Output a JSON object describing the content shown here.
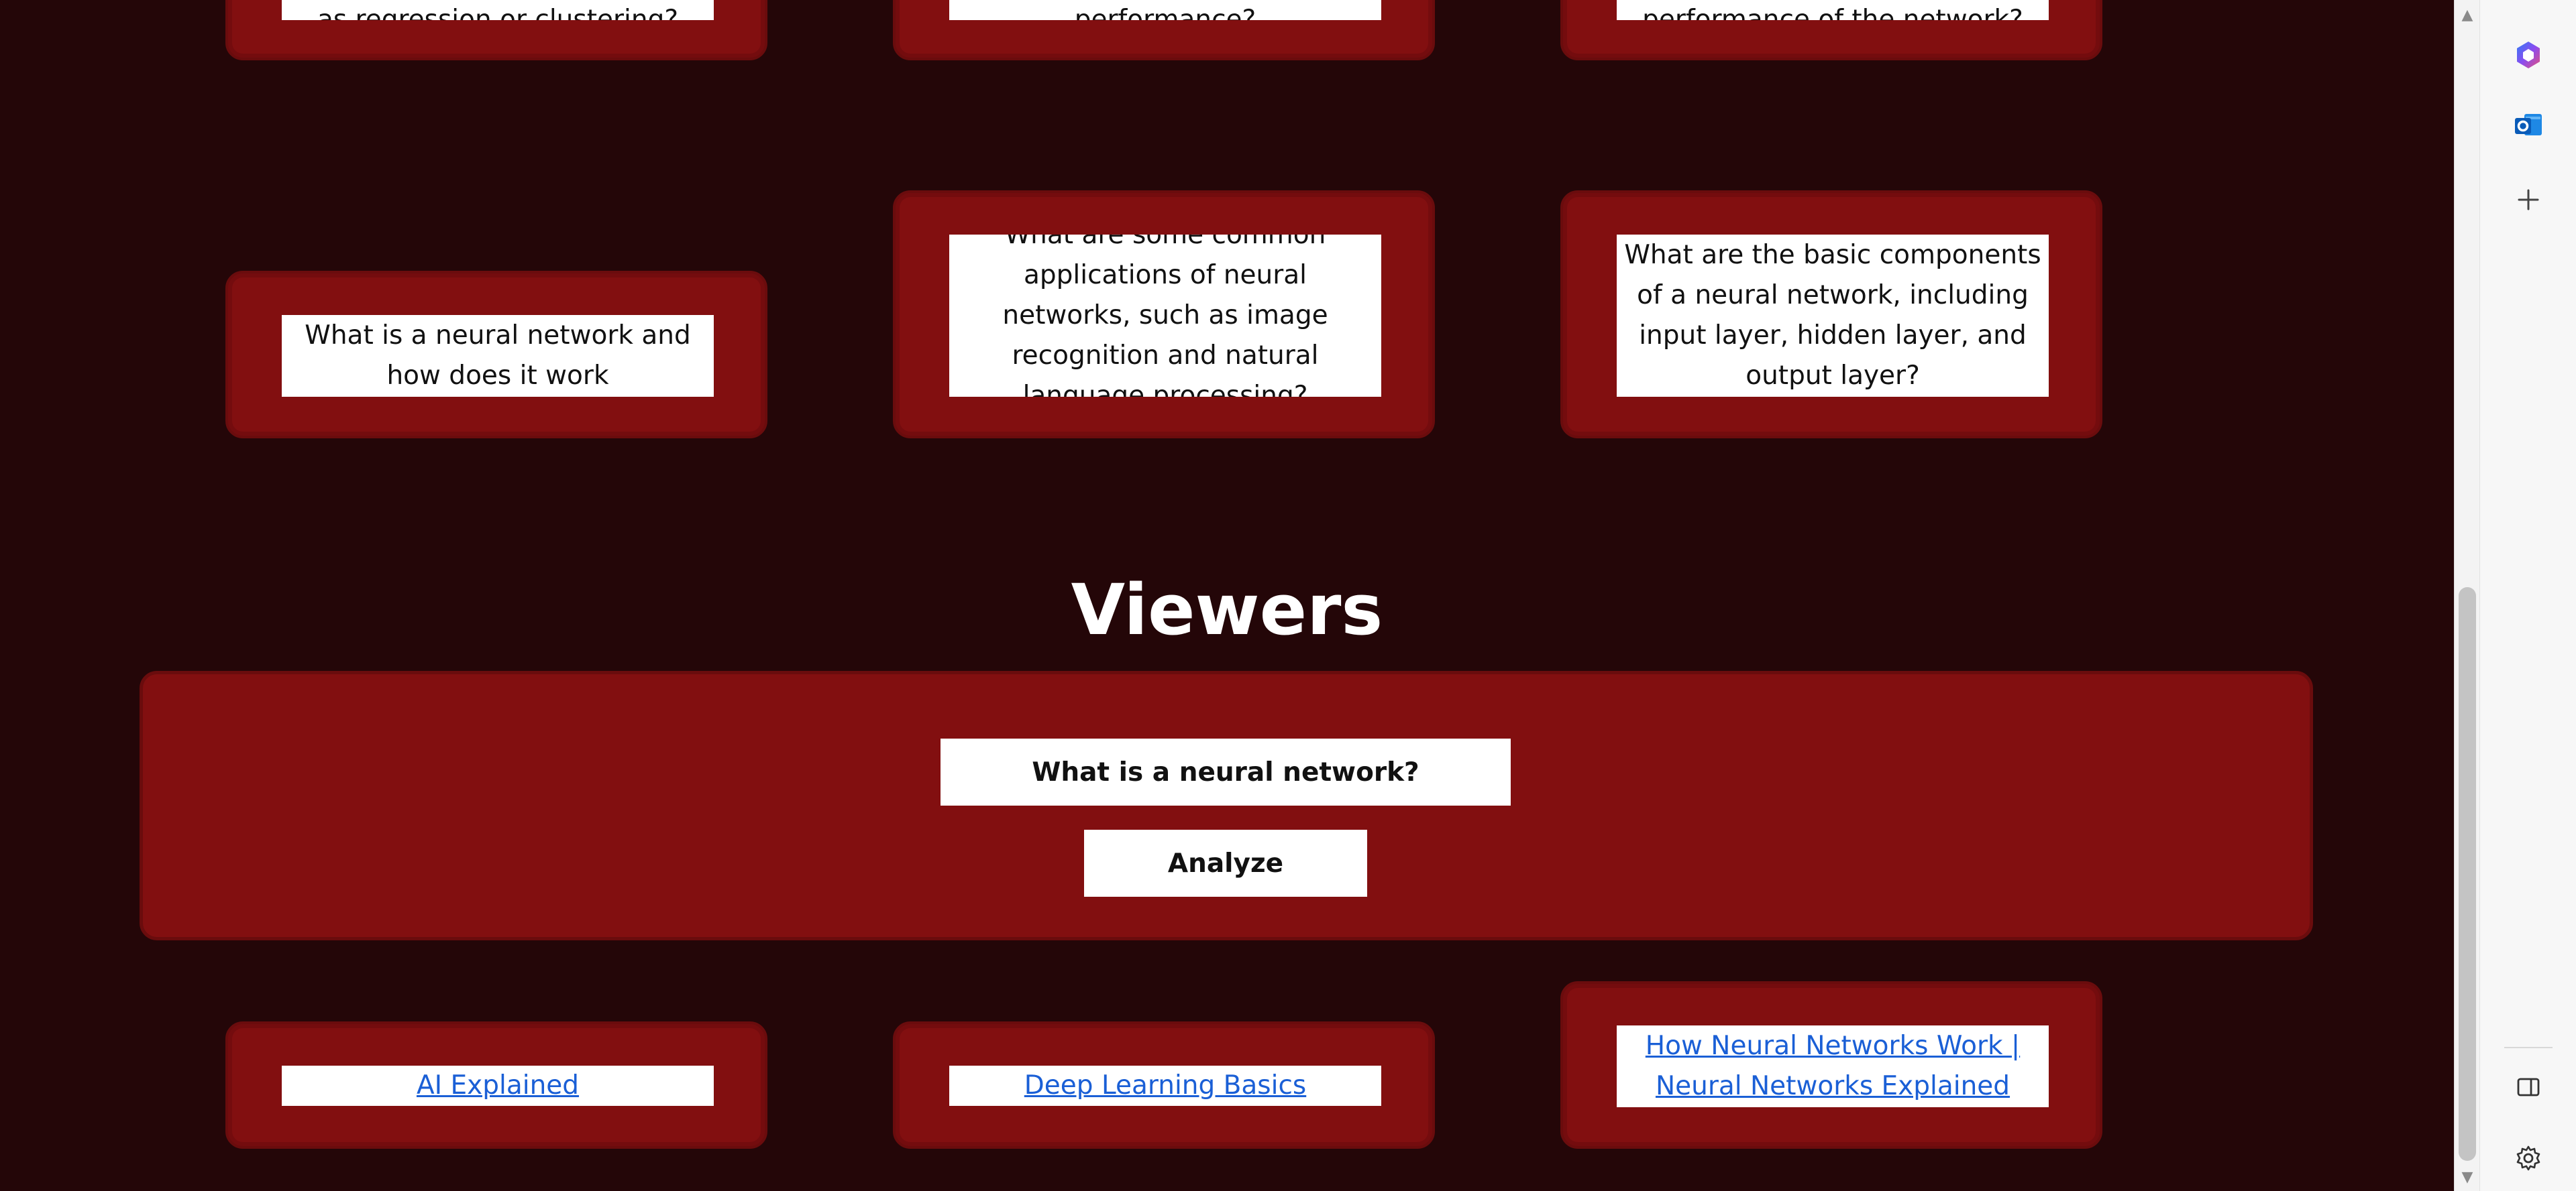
{
  "top_cards": [
    "as regression or clustering?",
    "performance?",
    "performance of the network?"
  ],
  "middle_cards": [
    "What is a neural network and how does it work",
    "What are some common applications of neural networks, such as image recognition and natural language processing?",
    "What are the basic components of a neural network, including input layer, hidden layer, and output layer?"
  ],
  "viewers": {
    "heading": "Viewers",
    "question": "What is a neural network?",
    "analyze_label": "Analyze"
  },
  "links": [
    "AI Explained",
    "Deep Learning Basics",
    "How Neural Networks Work | Neural Networks Explained"
  ],
  "scrollbar": {
    "up_arrow": "▲",
    "down_arrow": "▼"
  },
  "sidebar": {
    "icons": [
      "copilot-icon",
      "outlook-icon",
      "add-icon",
      "split-screen-icon",
      "settings-icon"
    ]
  },
  "colors": {
    "background": "#240608",
    "card": "#820f10",
    "link": "#1a5fd6"
  }
}
